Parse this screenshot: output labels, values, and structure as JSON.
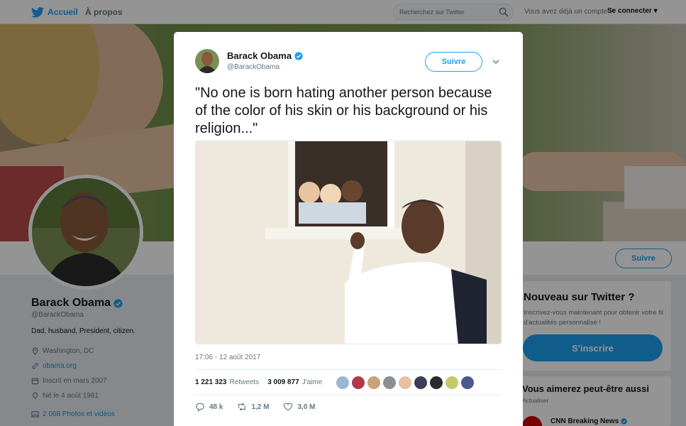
{
  "nav": {
    "home": "Accueil",
    "about": "À propos",
    "search_placeholder": "Recherchez sur Twitter",
    "login_prompt": "Vous avez déjà un compte ?",
    "login_link": "Se connecter"
  },
  "profile": {
    "name": "Barack Obama",
    "handle": "@BarackObama",
    "bio": "Dad, husband, President, citizen.",
    "location": "Washington, DC",
    "website": "obama.org",
    "joined": "Inscrit en mars 2007",
    "born": "Né le 4 août 1961",
    "photos": "2 068 Photos et vidéos",
    "follow_label": "Suivre"
  },
  "sidebar": {
    "new_title": "Nouveau sur Twitter ?",
    "new_text": "Inscrivez-vous maintenant pour obtenir votre fil d'actualités personnalisé !",
    "signup": "S'inscrire",
    "suggest_title": "Vous aimerez peut-être aussi",
    "update": "Actualiser",
    "suggest_name": "CNN Breaking News"
  },
  "tweet": {
    "author": "Barack Obama",
    "handle": "@BarackObama",
    "follow_label": "Suivre",
    "text": "\"No one is born hating another person because of the color of his skin or his background or his religion...\"",
    "timestamp": "17:06 - 12 août 2017",
    "retweets_count": "1 221 323",
    "retweets_label": "Retweets",
    "likes_count": "3 009 877",
    "likes_label": "J'aime",
    "replies": "48 k",
    "retweet_action": "1,2 M",
    "like_action": "3,0 M"
  },
  "colors": {
    "accent": "#1da1f2",
    "verified": "#1da1f2",
    "overlay": "rgba(0,0,0,0.42)"
  }
}
